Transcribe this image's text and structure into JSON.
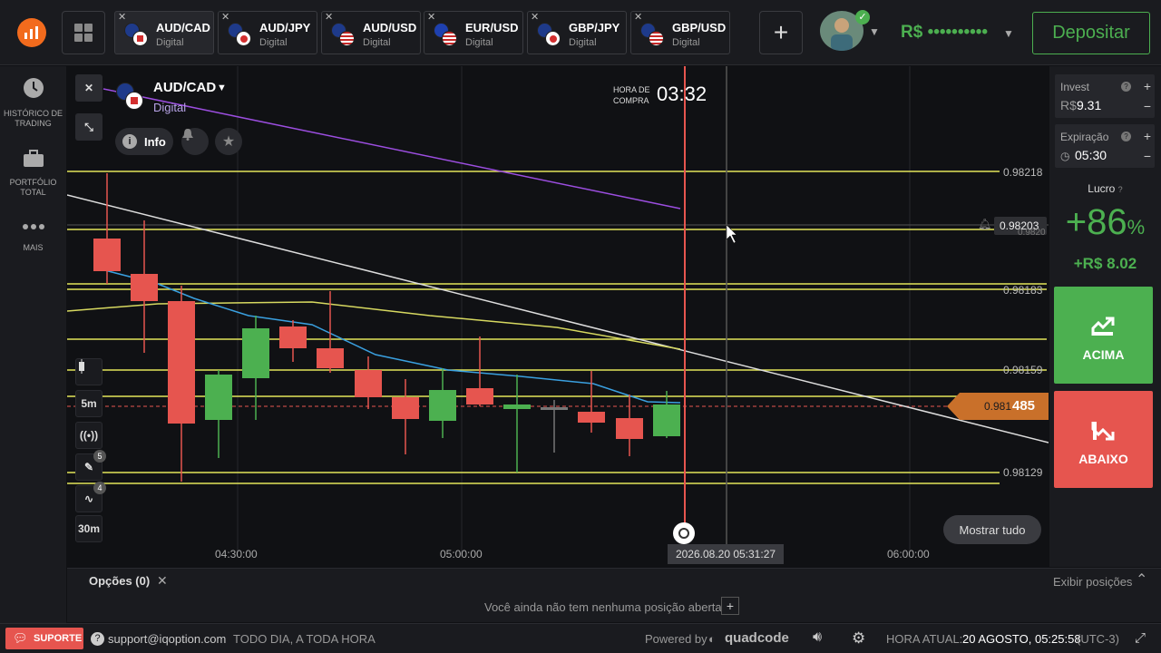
{
  "topbar": {
    "tabs": [
      {
        "name": "AUD/CAD",
        "sub": "Digital",
        "active": true
      },
      {
        "name": "AUD/JPY",
        "sub": "Digital",
        "active": false
      },
      {
        "name": "AUD/USD",
        "sub": "Digital",
        "active": false
      },
      {
        "name": "EUR/USD",
        "sub": "Digital",
        "active": false
      },
      {
        "name": "GBP/JPY",
        "sub": "Digital",
        "active": false
      },
      {
        "name": "GBP/USD",
        "sub": "Digital",
        "active": false
      }
    ],
    "balance": "R$ ••••••••••",
    "deposit_label": "Depositar"
  },
  "sidebar": {
    "items": [
      {
        "label": "HISTÓRICO DE TRADING",
        "icon": "clock-icon"
      },
      {
        "label": "PORTFÓLIO TOTAL",
        "icon": "briefcase-icon"
      },
      {
        "label": "MAIS",
        "icon": "more-icon"
      }
    ]
  },
  "chart": {
    "asset": "AUD/CAD",
    "asset_type": "Digital",
    "info_label": "Info",
    "hora_label": "HORA DE COMPRA",
    "timer": "03:32",
    "price_levels": [
      "0.98218",
      "0.98203",
      "0.9820",
      "0.98183",
      "0.98159",
      "0.98129"
    ],
    "current_price": "0.981",
    "current_price_suffix": "485",
    "time_labels": [
      "04:30:00",
      "05:00:00",
      "06:00:00"
    ],
    "cursor_date": "2026.08.20 05:31:27",
    "show_all_label": "Mostrar tudo",
    "timeframe_label": "5m",
    "interval_label": "30m",
    "drawing_badge": "5",
    "indicator_badge": "4"
  },
  "rightpanel": {
    "invest_label": "Invest",
    "invest_currency": "R$",
    "invest_value": "9.31",
    "expiration_label": "Expiração",
    "expiration_value": "05:30",
    "profit_label": "Lucro",
    "profit_percent": "+86",
    "profit_percent_sign": "%",
    "profit_value": "+R$ 8.02",
    "up_label": "ACIMA",
    "down_label": "ABAIXO"
  },
  "bottom": {
    "options_label": "Opções (0)",
    "no_position_text": "Você ainda não tem nenhuma posição aberta",
    "show_positions_label": "Exibir posições"
  },
  "footer": {
    "support_label": "SUPORTE",
    "email": "support@iqoption.com",
    "hours": "TODO DIA, A TODA HORA",
    "powered_by": "Powered by",
    "brand": "quadcode",
    "time_label": "HORA ATUAL:",
    "time_value": "20 AGOSTO, 05:25:58",
    "tz": "(UTC-3)"
  },
  "colors": {
    "up": "#4cb050",
    "down": "#e6554f",
    "level": "#e2e65a",
    "accent_orange": "#f26b1d"
  }
}
